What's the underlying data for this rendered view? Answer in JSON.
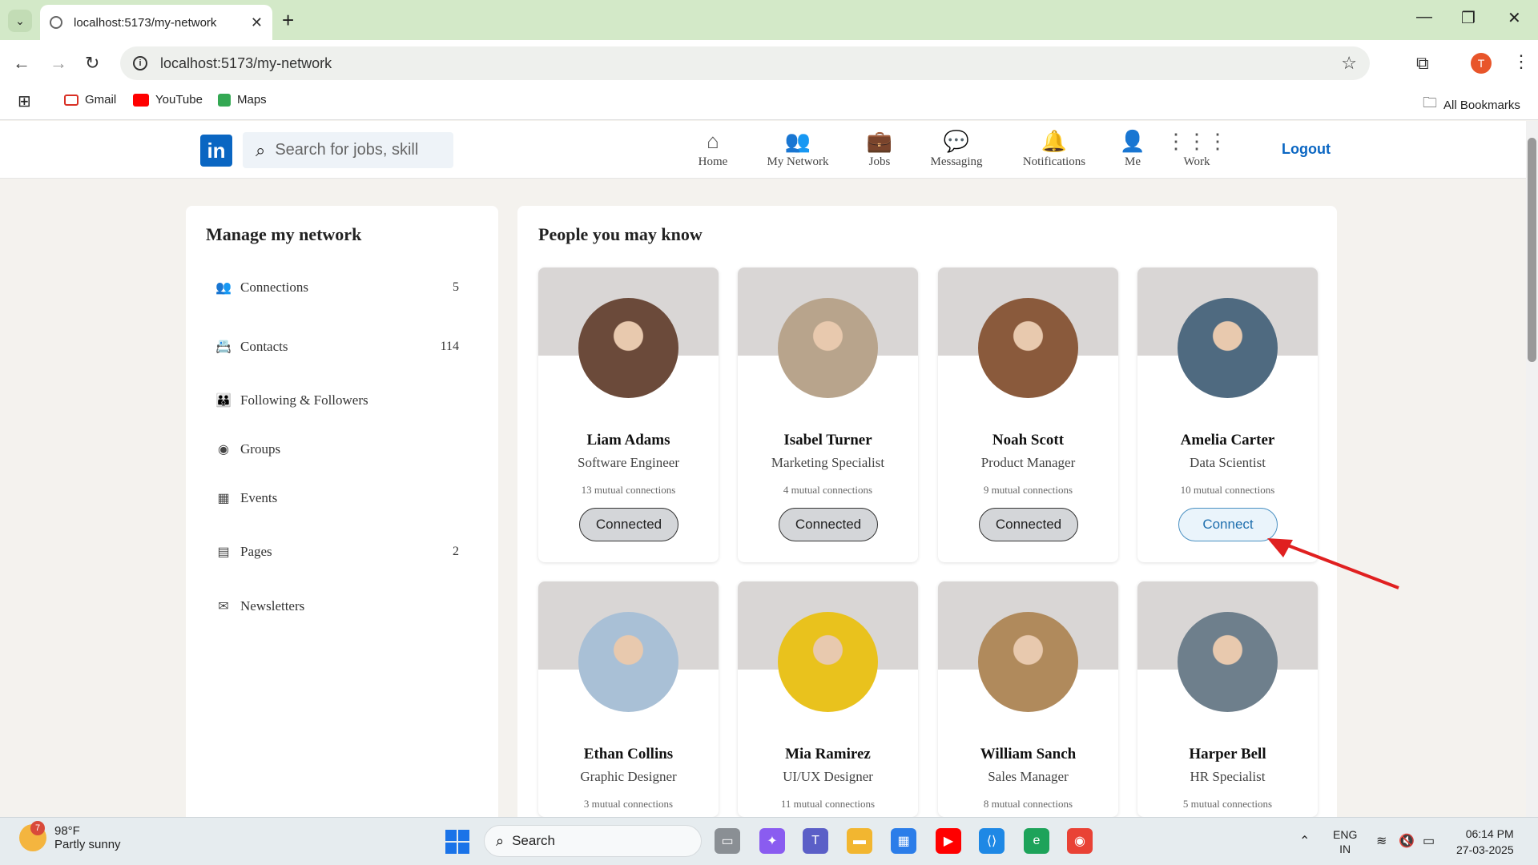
{
  "browser": {
    "tab_title": "localhost:5173/my-network",
    "url": "localhost:5173/my-network",
    "bookmarks": [
      "Gmail",
      "YouTube",
      "Maps"
    ],
    "all_bookmarks": "All Bookmarks",
    "profile_initial": "T"
  },
  "header": {
    "logo": "in",
    "search_placeholder": "Search for jobs, skill",
    "nav": [
      {
        "label": "Home",
        "icon": "home-icon"
      },
      {
        "label": "My Network",
        "icon": "network-icon"
      },
      {
        "label": "Jobs",
        "icon": "briefcase-icon"
      },
      {
        "label": "Messaging",
        "icon": "message-icon"
      },
      {
        "label": "Notifications",
        "icon": "bell-icon"
      },
      {
        "label": "Me",
        "icon": "user-icon"
      },
      {
        "label": "Work",
        "icon": "grid-icon"
      }
    ],
    "logout": "Logout"
  },
  "sidebar": {
    "title": "Manage my network",
    "items": [
      {
        "label": "Connections",
        "count": "5",
        "icon": "people-icon"
      },
      {
        "label": "Contacts",
        "count": "114",
        "icon": "contact-book-icon"
      },
      {
        "label": "Following & Followers",
        "count": "",
        "icon": "users-icon"
      },
      {
        "label": "Groups",
        "count": "",
        "icon": "group-icon"
      },
      {
        "label": "Events",
        "count": "",
        "icon": "calendar-icon"
      },
      {
        "label": "Pages",
        "count": "2",
        "icon": "page-icon"
      },
      {
        "label": "Newsletters",
        "count": "",
        "icon": "envelope-icon"
      }
    ]
  },
  "main": {
    "title": "People you may know",
    "people": [
      {
        "name": "Liam Adams",
        "role": "Software Engineer",
        "mutual": "13 mutual connections",
        "button": "Connected",
        "state": "connected",
        "avatar_color": "#6b4a3a"
      },
      {
        "name": "Isabel Turner",
        "role": "Marketing Specialist",
        "mutual": "4 mutual connections",
        "button": "Connected",
        "state": "connected",
        "avatar_color": "#b8a48c"
      },
      {
        "name": "Noah Scott",
        "role": "Product Manager",
        "mutual": "9 mutual connections",
        "button": "Connected",
        "state": "connected",
        "avatar_color": "#8a5a3c"
      },
      {
        "name": "Amelia Carter",
        "role": "Data Scientist",
        "mutual": "10 mutual connections",
        "button": "Connect",
        "state": "connect",
        "avatar_color": "#4f6a80"
      },
      {
        "name": "Ethan Collins",
        "role": "Graphic Designer",
        "mutual": "3 mutual connections",
        "button": "",
        "state": "",
        "avatar_color": "#a9c0d6"
      },
      {
        "name": "Mia Ramirez",
        "role": "UI/UX Designer",
        "mutual": "11 mutual connections",
        "button": "",
        "state": "",
        "avatar_color": "#e9c21d"
      },
      {
        "name": "William Sanch",
        "role": "Sales Manager",
        "mutual": "8 mutual connections",
        "button": "",
        "state": "",
        "avatar_color": "#b08a5c"
      },
      {
        "name": "Harper Bell",
        "role": "HR Specialist",
        "mutual": "5 mutual connections",
        "button": "",
        "state": "",
        "avatar_color": "#6e7f8c"
      }
    ]
  },
  "taskbar": {
    "weather_temp": "98°F",
    "weather_desc": "Partly sunny",
    "weather_badge": "7",
    "search_label": "Search",
    "lang_top": "ENG",
    "lang_bottom": "IN",
    "time": "06:14 PM",
    "date": "27-03-2025"
  },
  "colors": {
    "brand": "#0a66c2",
    "chrome_tab_bg": "#d3e9c8",
    "annotation_arrow": "#e02020"
  }
}
